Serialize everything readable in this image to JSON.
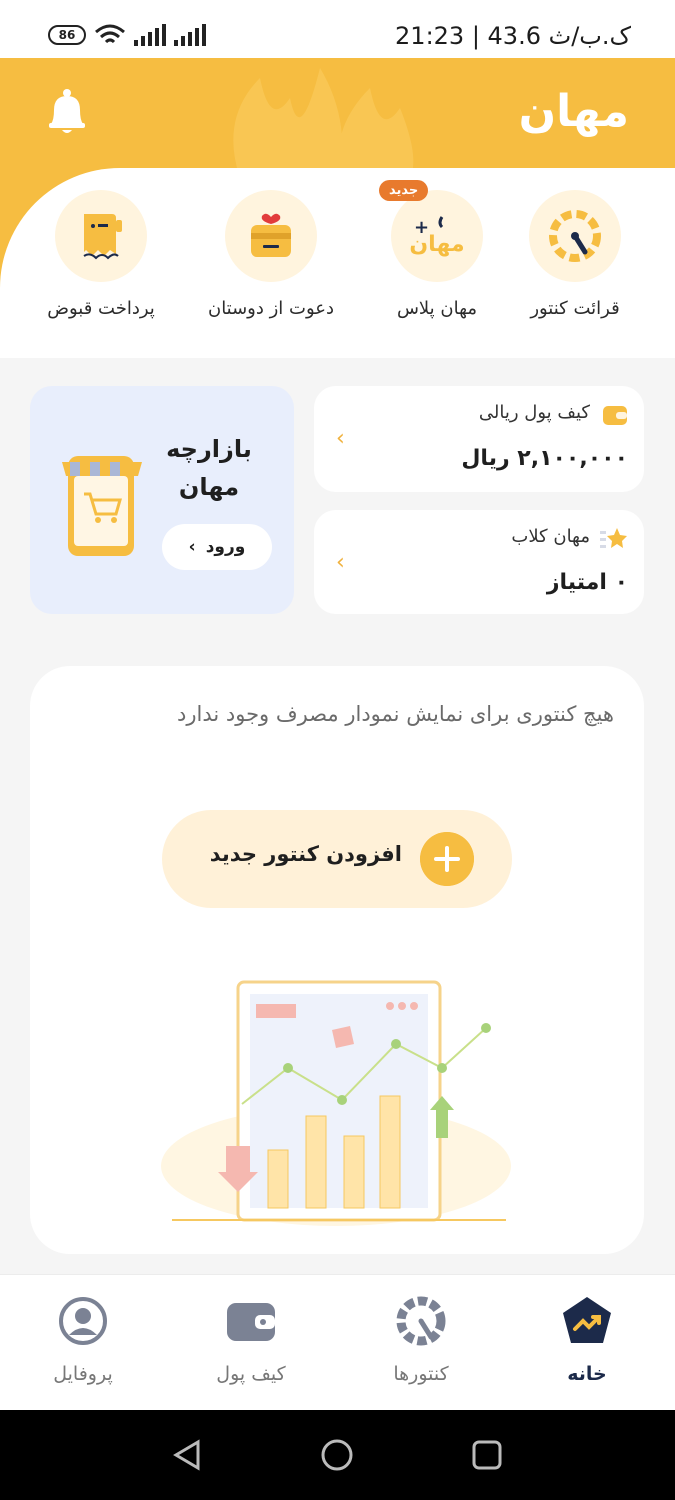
{
  "status_bar": {
    "time_speed": "21:23 | 43.6 ک.ب/ث",
    "battery": "86",
    "icons": [
      "wifi-icon",
      "signal-icon",
      "app-notification-icon"
    ]
  },
  "header": {
    "logo": "مهان",
    "bell_icon": "bell-icon",
    "brand_color": "#f6bd41"
  },
  "quick_actions": [
    {
      "label": "قرائت کنتور",
      "icon": "meter-gauge-icon"
    },
    {
      "label": "مهان پلاس",
      "icon": "mahan-plus-icon",
      "badge": "جدید"
    },
    {
      "label": "دعوت از دوستان",
      "icon": "gift-invite-icon"
    },
    {
      "label": "پرداخت قبوض",
      "icon": "bill-receipt-icon"
    }
  ],
  "wallet_card": {
    "title": "کیف پول ریالی",
    "value": "۲,۱۰۰,۰۰۰ ریال",
    "icon": "wallet-icon"
  },
  "club_card": {
    "title": "مهان کلاب",
    "value": "۰ امتیاز",
    "icon": "star-icon"
  },
  "market_card": {
    "title": "بازارچه مهان",
    "login_label": "ورود",
    "icon": "shop-cart-icon"
  },
  "chart_section": {
    "empty_message": "هیچ کنتوری برای نمایش نمودار مصرف وجود ندارد",
    "add_button_label": "افزودن کنتور جدید"
  },
  "bottom_nav": [
    {
      "label": "خانه",
      "icon": "home-chart-icon",
      "active": true
    },
    {
      "label": "کنتورها",
      "icon": "meters-gauge-icon",
      "active": false
    },
    {
      "label": "کیف پول",
      "icon": "wallet-icon",
      "active": false
    },
    {
      "label": "پروفایل",
      "icon": "profile-icon",
      "active": false
    }
  ],
  "colors": {
    "accent": "#f6bd41",
    "accent_light": "#fff4de",
    "active_nav": "#1c2a4a",
    "market_bg": "#e8eefc"
  }
}
